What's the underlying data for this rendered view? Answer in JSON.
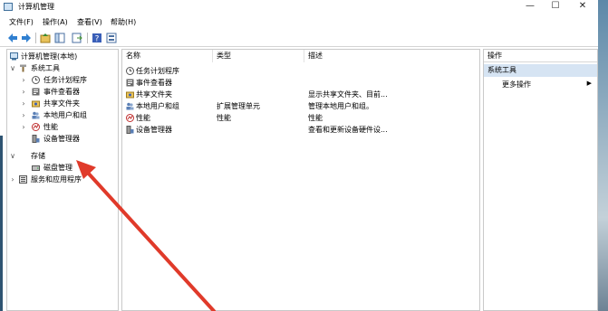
{
  "window": {
    "title": "计算机管理",
    "controls": [
      "—",
      "☐",
      "✕"
    ]
  },
  "menu": [
    "文件(F)",
    "操作(A)",
    "查看(V)",
    "帮助(H)"
  ],
  "tree": [
    {
      "label": "计算机管理(本地)",
      "level": 0,
      "caret": ""
    },
    {
      "label": "系统工具",
      "level": 1,
      "caret": "∨"
    },
    {
      "label": "任务计划程序",
      "level": 2,
      "caret": "›"
    },
    {
      "label": "事件查看器",
      "level": 2,
      "caret": "›"
    },
    {
      "label": "共享文件夹",
      "level": 2,
      "caret": "›"
    },
    {
      "label": "本地用户和组",
      "level": 2,
      "caret": "›"
    },
    {
      "label": "性能",
      "level": 2,
      "caret": "›"
    },
    {
      "label": "设备管理器",
      "level": 2,
      "caret": ""
    },
    {
      "label": "存储",
      "level": 1,
      "caret": "∨"
    },
    {
      "label": "磁盘管理",
      "level": 2,
      "caret": ""
    },
    {
      "label": "服务和应用程序",
      "level": 1,
      "caret": "›"
    }
  ],
  "list": {
    "columns": [
      "名称",
      "类型",
      "描述"
    ],
    "rows": [
      {
        "name": "任务计划程序",
        "type": "",
        "desc": ""
      },
      {
        "name": "事件查看器",
        "type": "",
        "desc": ""
      },
      {
        "name": "共享文件夹",
        "type": "",
        "desc": "显示共享文件夹、目前..."
      },
      {
        "name": "本地用户和组",
        "type": "扩展管理单元",
        "desc": "管理本地用户和组。"
      },
      {
        "name": "性能",
        "type": "性能",
        "desc": "性能"
      },
      {
        "name": "设备管理器",
        "type": "",
        "desc": "查看和更新设备硬件设..."
      }
    ]
  },
  "actions": {
    "header": "操作",
    "section": "系统工具",
    "more": "更多操作",
    "more_arrow": "▶"
  },
  "colors": {
    "selection": "#d6e4f3",
    "arrow": "#e03a2a"
  }
}
